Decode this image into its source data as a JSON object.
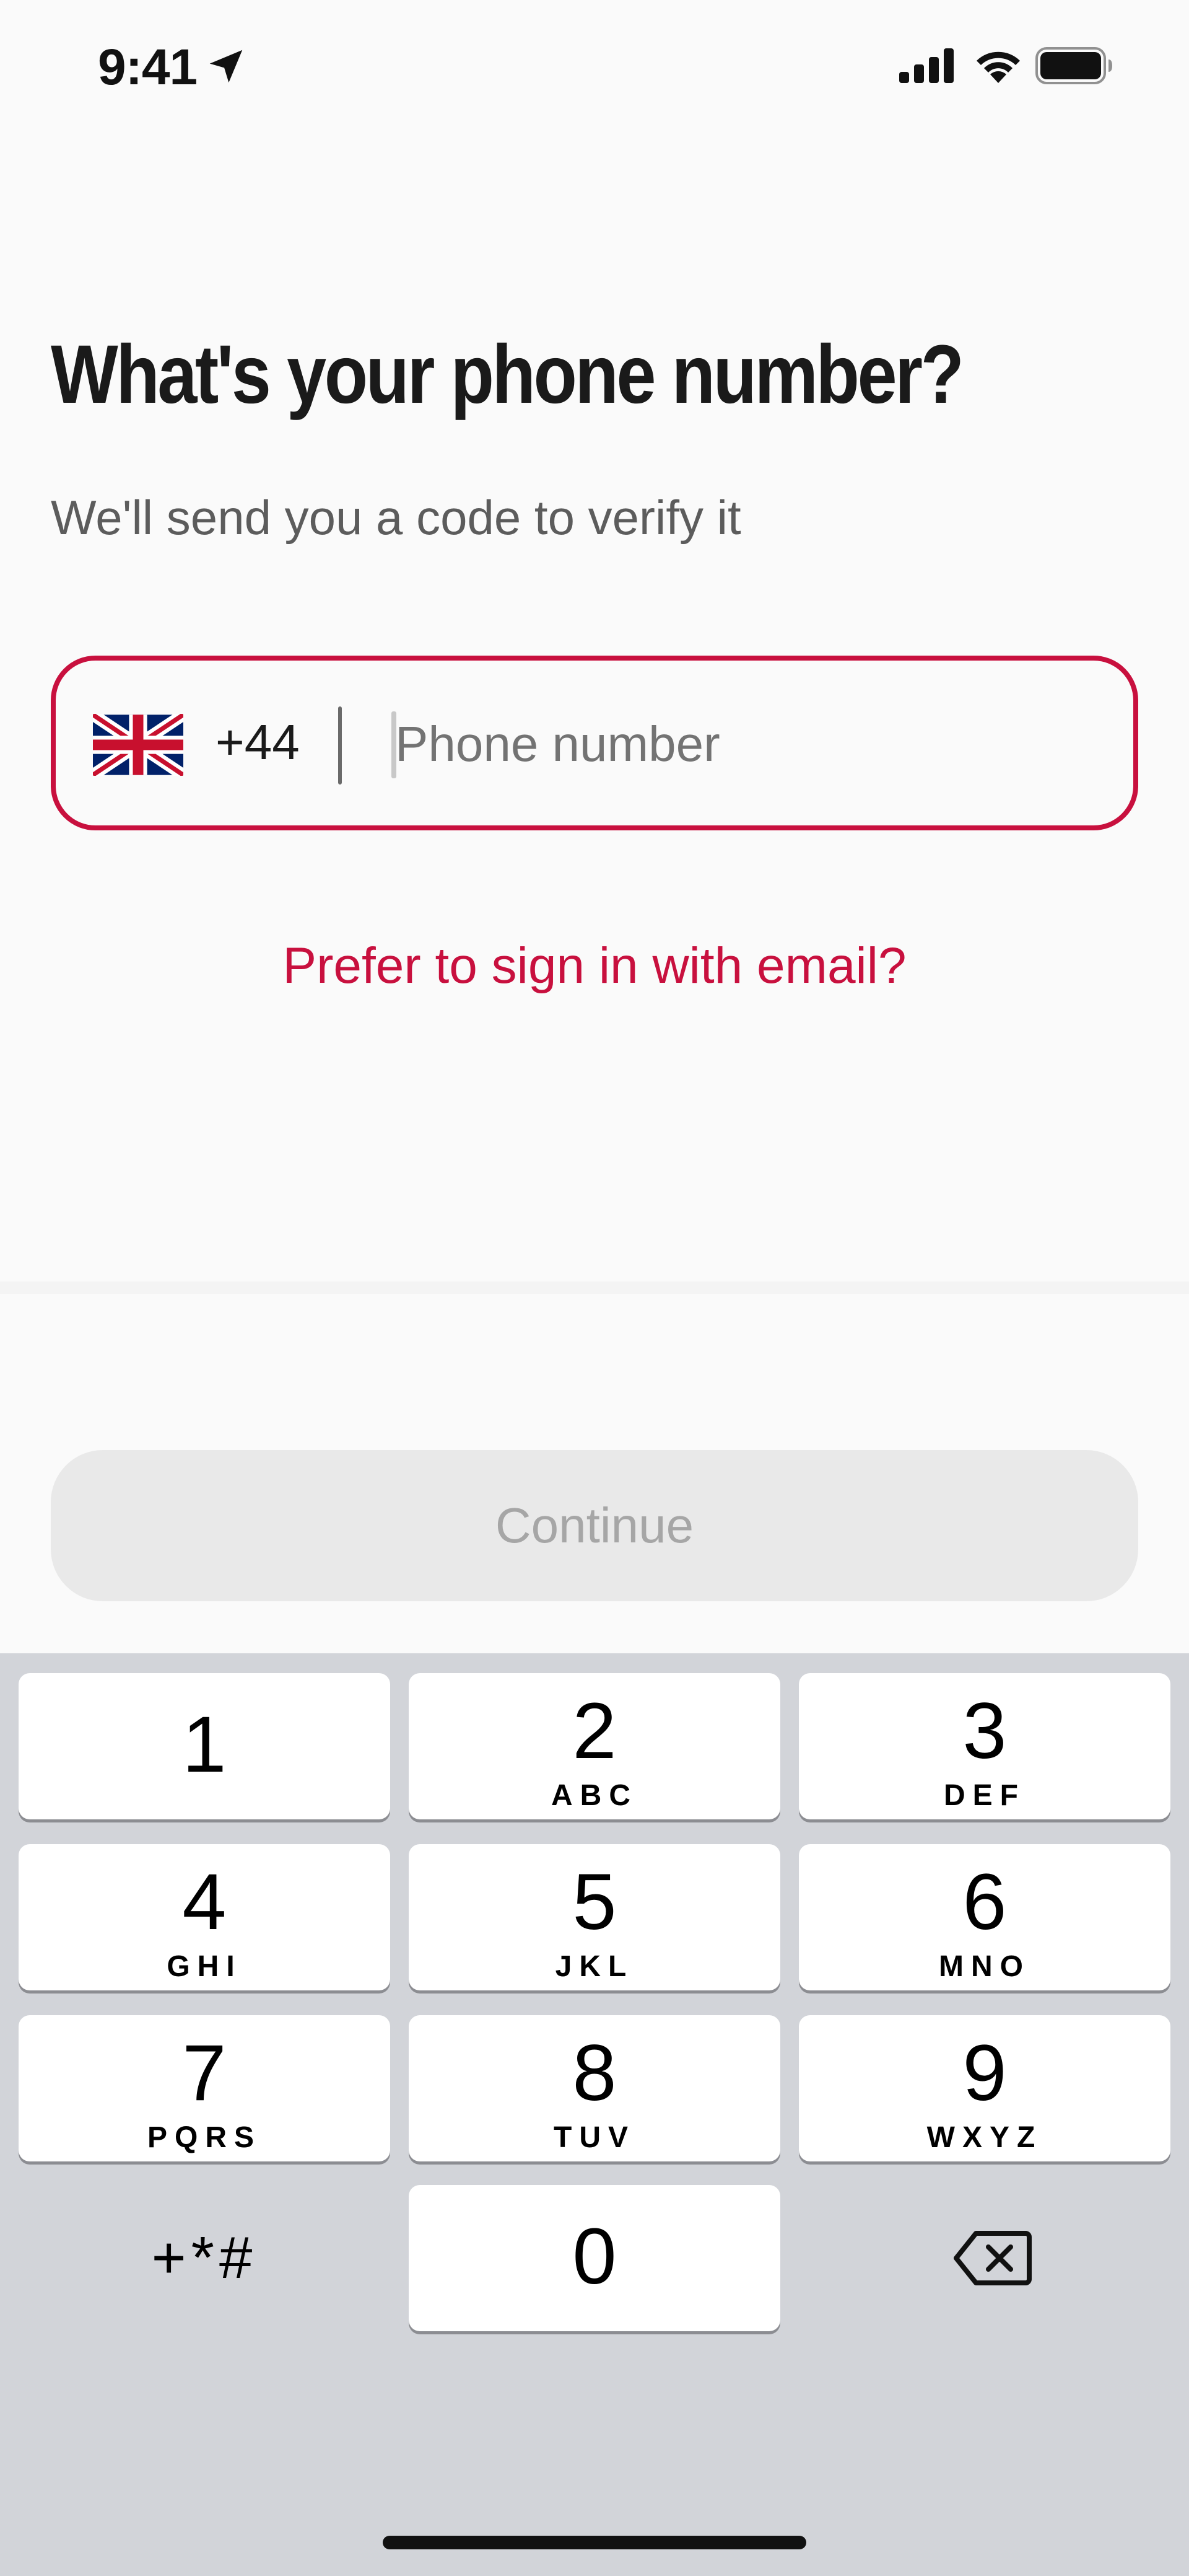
{
  "status_bar": {
    "time": "9:41"
  },
  "page": {
    "title": "What's your phone number?",
    "subtitle": "We'll send you a code to verify it"
  },
  "phone_field": {
    "country_code": "+44",
    "placeholder": "Phone number",
    "value": "",
    "flag": "uk-flag-icon"
  },
  "email_link": "Prefer to sign in with email?",
  "continue_button": {
    "label": "Continue",
    "enabled": false
  },
  "keypad": {
    "keys": [
      {
        "digit": "1",
        "letters": ""
      },
      {
        "digit": "2",
        "letters": "ABC"
      },
      {
        "digit": "3",
        "letters": "DEF"
      },
      {
        "digit": "4",
        "letters": "GHI"
      },
      {
        "digit": "5",
        "letters": "JKL"
      },
      {
        "digit": "6",
        "letters": "MNO"
      },
      {
        "digit": "7",
        "letters": "PQRS"
      },
      {
        "digit": "8",
        "letters": "TUV"
      },
      {
        "digit": "9",
        "letters": "WXYZ"
      },
      {
        "digit": "0",
        "letters": ""
      }
    ],
    "symbols": "+*#"
  },
  "colors": {
    "accent": "#c8103e",
    "background": "#fafafa",
    "keypad_background": "#d2d4d9"
  }
}
